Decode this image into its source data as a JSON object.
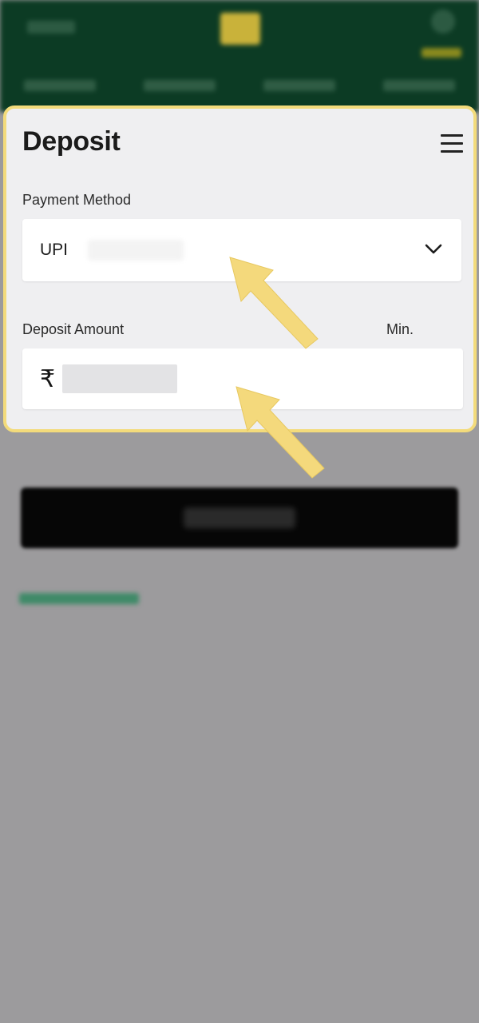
{
  "panel": {
    "title": "Deposit",
    "payment_method_label": "Payment Method",
    "payment_method_value": "UPI",
    "deposit_amount_label": "Deposit Amount",
    "min_label": "Min.",
    "currency_symbol": "₹"
  },
  "icons": {
    "menu": "hamburger-menu-icon",
    "dropdown": "chevron-down-icon",
    "annotation": "arrow-pointer"
  },
  "colors": {
    "highlight_border": "#f3db7b",
    "arrow_fill": "#f4d97c",
    "header_bg": "#0c3b24",
    "overlay_bg": "#9c9b9d",
    "panel_bg": "#efeff1"
  }
}
